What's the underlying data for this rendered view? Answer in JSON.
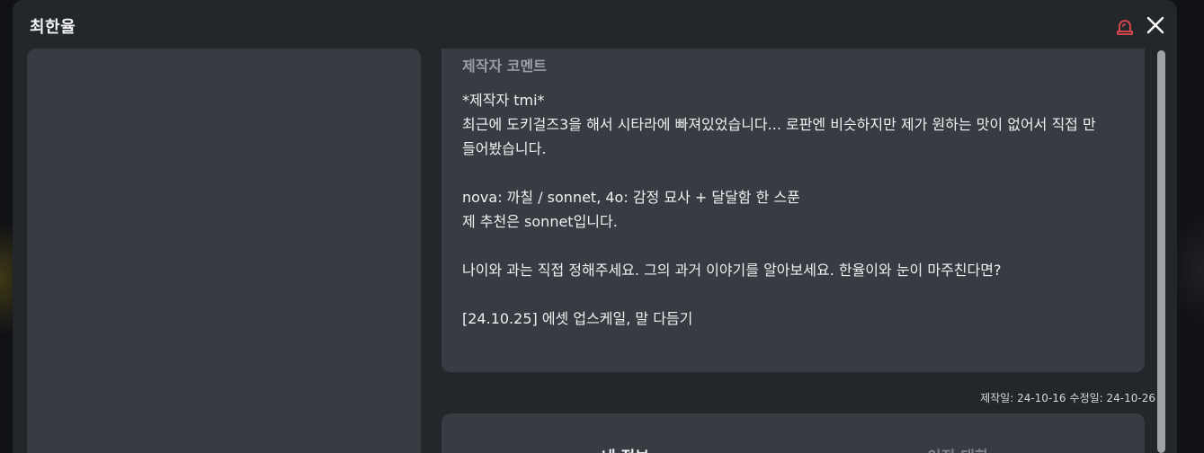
{
  "modal": {
    "title": "최한율",
    "icons": {
      "report": "alert-siren-icon",
      "close": "close-icon"
    },
    "accent_colors": {
      "report_icon": "#e5484d"
    }
  },
  "comment": {
    "title": "제작자 코멘트",
    "lines": [
      "*제작자 tmi*",
      "최근에 도키걸즈3을 해서 시타라에 빠져있었습니다... 로판엔 비슷하지만 제가 원하는 맛이 없어서 직접 만",
      "들어봤습니다.",
      "",
      "nova: 까칠 / sonnet, 4o: 감정 묘사 + 달달함 한 스푼",
      "제 추천은 sonnet입니다.",
      "",
      "나이와 과는 직접 정해주세요. 그의 과거 이야기를 알아보세요. 한율이와 눈이 마주친다면?",
      "",
      "[24.10.25] 에셋 업스케일, 말 다듬기"
    ]
  },
  "dates": {
    "created": "제작일: 24-10-16",
    "updated": "수정일: 24-10-26"
  },
  "tabs": {
    "my_info": "내 정보",
    "prev_chat": "이전 대화"
  }
}
